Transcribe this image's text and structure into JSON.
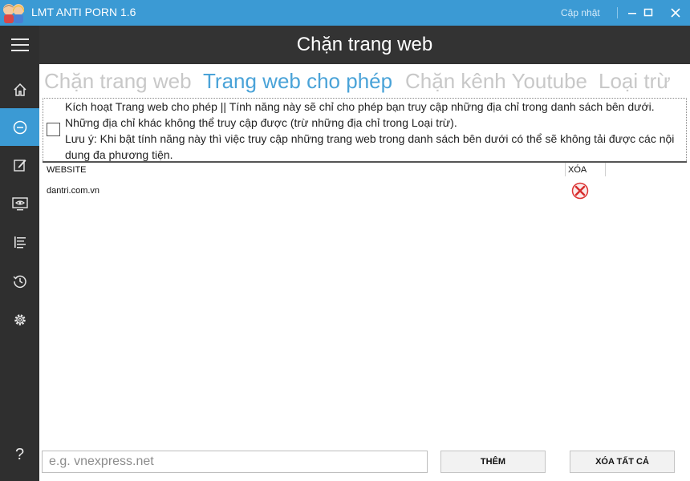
{
  "window": {
    "title": "LMT ANTI PORN 1.6",
    "update_label": "Cập nhật",
    "controls": [
      "minimize-icon",
      "maximize-icon",
      "close-icon"
    ]
  },
  "sidebar": {
    "items": [
      {
        "icon": "menu-icon"
      },
      {
        "icon": "home-icon"
      },
      {
        "icon": "block-icon",
        "active": true
      },
      {
        "icon": "edit-icon"
      },
      {
        "icon": "monitor-eye-icon"
      },
      {
        "icon": "list-icon"
      },
      {
        "icon": "history-icon"
      },
      {
        "icon": "gear-icon"
      },
      {
        "icon": "help-icon",
        "text": "?"
      }
    ]
  },
  "header": {
    "title": "Chặn trang web"
  },
  "tabs": [
    {
      "label": "Chặn trang web",
      "active": false
    },
    {
      "label": "Trang web cho phép",
      "active": true
    },
    {
      "label": "Chặn kênh Youtube",
      "active": false
    },
    {
      "label": "Loại trừ",
      "active": false
    }
  ],
  "notice": {
    "checked": false,
    "line1": "Kích hoạt Trang web cho phép || Tính năng này sẽ chỉ cho phép bạn truy cập những địa chỉ trong danh sách bên dưới. Những địa chỉ khác không thể truy cập được (trừ những địa chỉ trong Loại trừ).",
    "line2": "Lưu ý: Khi bật tính năng này thì việc truy cập những trang web trong danh sách bên dưới có thể sẽ không tải được các nội dung đa phương tiện."
  },
  "table": {
    "columns": [
      "WEBSITE",
      "XÓA"
    ],
    "rows": [
      {
        "website": "dantri.com.vn"
      }
    ]
  },
  "footer": {
    "input_placeholder": "e.g. vnexpress.net",
    "input_value": "",
    "add_label": "THÊM",
    "clear_all_label": "XÓA TẤT CẢ"
  },
  "colors": {
    "accent": "#3b9ad4",
    "sidebar_bg": "#2f2f2f",
    "header_bg": "#333333",
    "inactive_tab": "#c8c8c8",
    "active_tab": "#4aa3d8"
  }
}
